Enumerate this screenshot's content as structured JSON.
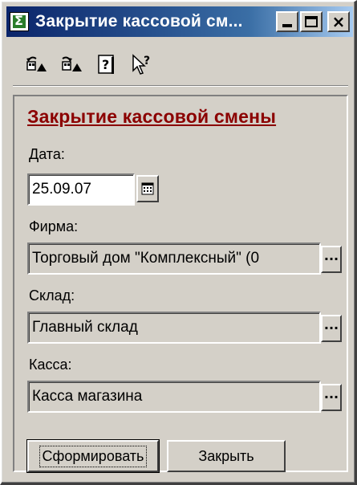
{
  "window": {
    "title": "Закрытие кассовой см...",
    "controls": {
      "minimize": "minimize",
      "maximize": "maximize",
      "close": "×"
    }
  },
  "toolbar": {
    "icons": [
      "undo-icon",
      "redo-icon",
      "help-icon",
      "context-help-icon"
    ]
  },
  "form": {
    "title": "Закрытие кассовой смены",
    "date": {
      "label": "Дата:",
      "value": "25.09.07"
    },
    "firm": {
      "label": "Фирма:",
      "value": "Торговый дом \"Комплексный\" (0"
    },
    "warehouse": {
      "label": "Склад:",
      "value": "Главный склад"
    },
    "cashbox": {
      "label": "Касса:",
      "value": "Касса магазина"
    },
    "ellipsis": "..."
  },
  "buttons": {
    "generate": "Сформировать",
    "close": "Закрыть"
  },
  "colors": {
    "titlebar_start": "#0a246a",
    "titlebar_end": "#a6caf0",
    "form_title": "#8b0000",
    "window_bg": "#d4d0c8"
  }
}
